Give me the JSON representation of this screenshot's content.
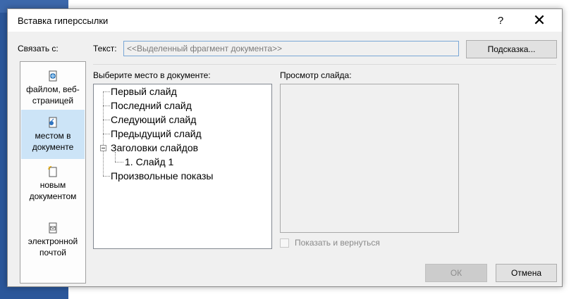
{
  "window": {
    "title": "Вставка гиперссылки",
    "help_glyph": "?",
    "close_glyph": "✕"
  },
  "link_to": {
    "label": "Связать с:",
    "items": [
      {
        "label": "файлом, веб-страницей",
        "icon": "web-page-icon",
        "selected": false
      },
      {
        "label": "местом в документе",
        "icon": "place-in-document-icon",
        "selected": true
      },
      {
        "label": "новым документом",
        "icon": "new-document-icon",
        "selected": false
      },
      {
        "label": "электронной почтой",
        "icon": "email-icon",
        "selected": false
      }
    ]
  },
  "text_to_display": {
    "label": "Текст:",
    "value": "<<Выделенный фрагмент документа>>"
  },
  "screentip_button": "Подсказка...",
  "place_tree": {
    "label": "Выберите место в документе:",
    "items": [
      {
        "text": "Первый слайд"
      },
      {
        "text": "Последний слайд"
      },
      {
        "text": "Следующий слайд"
      },
      {
        "text": "Предыдущий слайд"
      },
      {
        "text": "Заголовки слайдов"
      },
      {
        "text": "1. Слайд 1"
      },
      {
        "text": "Произвольные показы"
      }
    ]
  },
  "preview": {
    "label": "Просмотр слайда:",
    "show_and_return": "Показать и вернуться"
  },
  "buttons": {
    "ok": "ОК",
    "cancel": "Отмена"
  },
  "colors": {
    "selected_item": "#cce4f7",
    "window_bg": "#f0f0f0",
    "backdrop": "#2b579a"
  }
}
